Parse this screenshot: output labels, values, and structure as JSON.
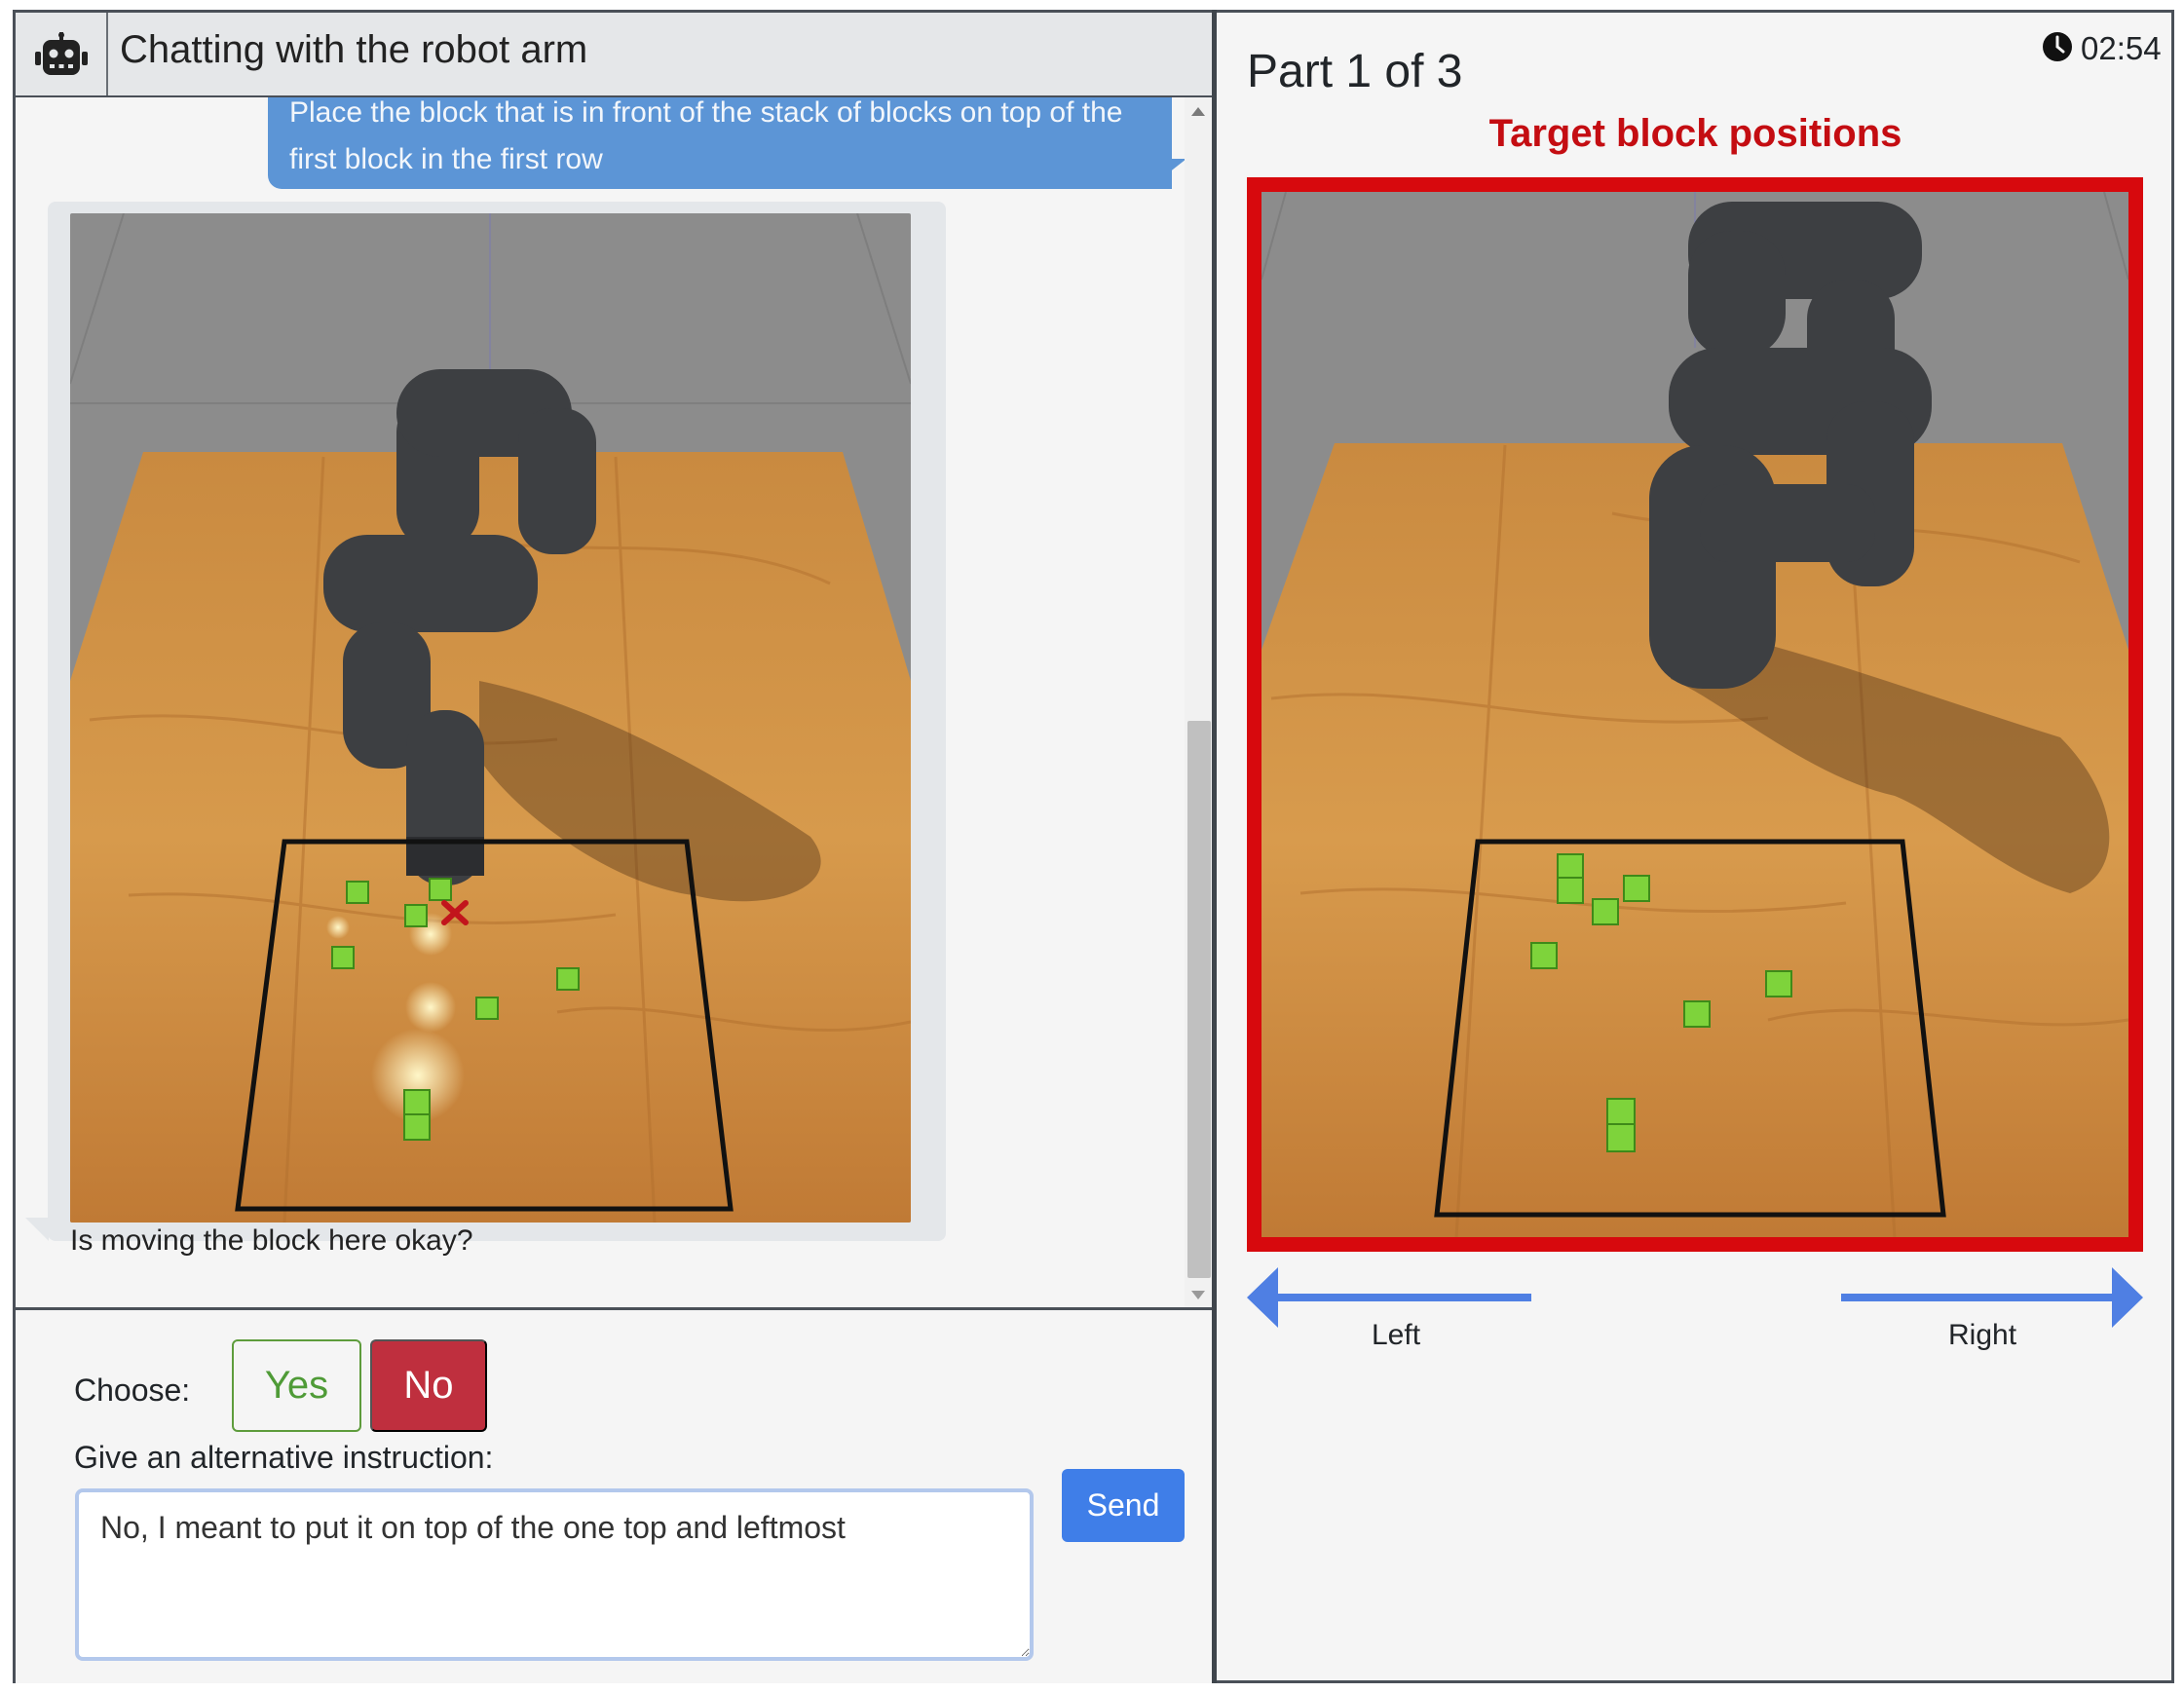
{
  "chat": {
    "title": "Chatting with the robot arm",
    "header_icon": "robot-icon",
    "messages": [
      {
        "sender": "user",
        "text": "Place the block that is in front of the stack of blocks on top of the first block in the first row"
      },
      {
        "sender": "robot",
        "image": "robot-arm-proposed-move",
        "text": "Is moving the block here okay?"
      }
    ]
  },
  "response": {
    "choose_label": "Choose:",
    "yes_label": "Yes",
    "no_label": "No",
    "alt_label": "Give an alternative instruction:",
    "input_value": "No, I meant to put it on top of the one top and leftmost",
    "send_label": "Send"
  },
  "task": {
    "part_label": "Part 1 of 3",
    "timer": "02:54",
    "timer_icon": "clock-icon",
    "target_title": "Target block positions",
    "target_image": "robot-arm-target-positions",
    "nav_left_label": "Left",
    "nav_left_icon": "arrow-left-icon",
    "nav_right_label": "Right",
    "nav_right_icon": "arrow-right-icon"
  },
  "colors": {
    "user_bubble": "#5c95d6",
    "bot_bubble": "#e4e7ea",
    "yes_green": "#4f9b37",
    "no_red": "#bf2f3e",
    "send_blue": "#3f7ee8",
    "target_red": "#d7090d",
    "nav_arrow_blue": "#4f7fe3"
  }
}
